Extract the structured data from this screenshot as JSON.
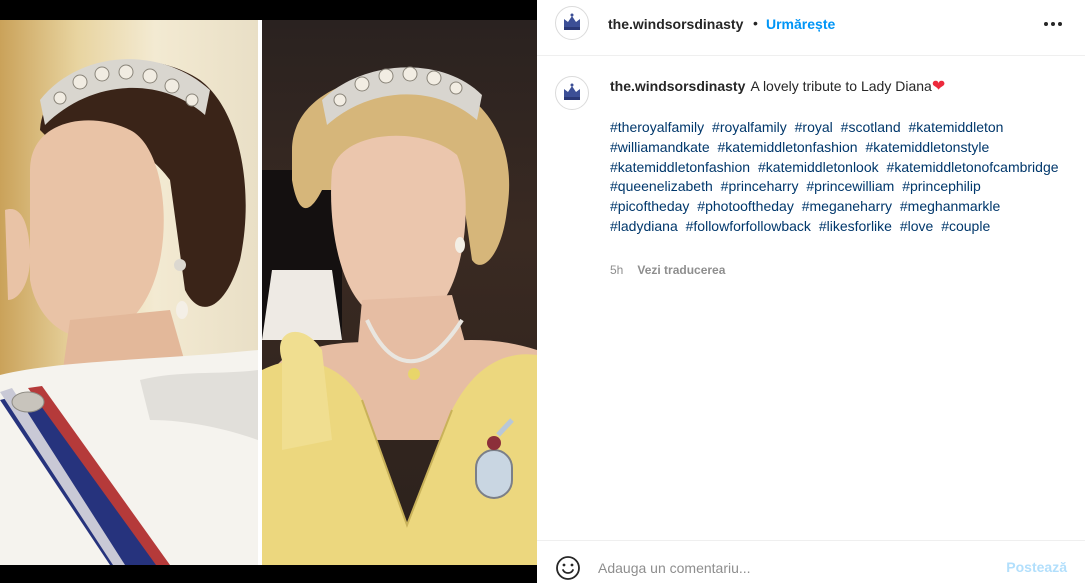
{
  "post": {
    "username": "the.windsorsdinasty",
    "follow_separator": "•",
    "follow_label": "Urmărește",
    "more_icon": "more-options-icon",
    "avatar_icon": "royal-crest-icon"
  },
  "caption": {
    "username": "the.windsorsdinasty",
    "text": "A lovely tribute to Lady Diana",
    "heart_emoji": "❤",
    "hashtags": [
      "#theroyalfamily",
      "#royalfamily",
      "#royal",
      "#scotland",
      "#katemiddleton",
      "#williamandkate",
      "#katemiddletonfashion",
      "#katemiddletonstyle",
      "#katemiddletonfashion",
      "#katemiddletonlook",
      "#katemiddletonofcambridge",
      "#queenelizabeth",
      "#princeharry",
      "#princewilliam",
      "#princephilip",
      "#picoftheday",
      "#photooftheday",
      "#meganeharry",
      "#meghanmarkle",
      "#ladydiana",
      "#followforfollowback",
      "#likesforlike",
      "#love",
      "#couple"
    ],
    "time": "5h",
    "translate_label": "Vezi traducerea"
  },
  "comment": {
    "placeholder": "Adauga un comentariu...",
    "post_label": "Postează",
    "emoji_icon": "emoji-smile-icon"
  },
  "colors": {
    "link": "#00376b",
    "follow": "#0095f6",
    "post_disabled": "#b2dffc",
    "meta": "#8e8e8e"
  }
}
